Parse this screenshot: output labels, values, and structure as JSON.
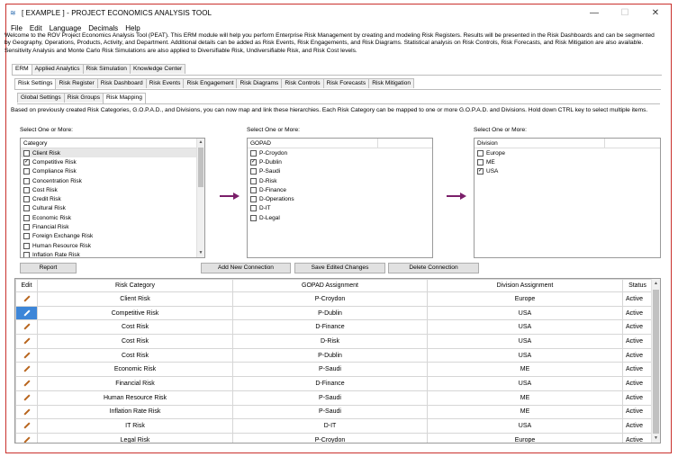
{
  "window": {
    "title": "[ EXAMPLE ] - PROJECT ECONOMICS ANALYSIS TOOL",
    "controls": {
      "minimize": "—",
      "maximize": "☐",
      "close": "✕"
    }
  },
  "menu": [
    "File",
    "Edit",
    "Language",
    "Decimals",
    "Help"
  ],
  "intro": "Welcome to the ROV Project Economics Analysis Tool (PEAT). This ERM module will help you perform Enterprise Risk Management by creating and modeling Risk Registers. Results will be presented in the Risk Dashboards and can be segmented by Geography, Operations, Products, Activity, and Department. Additional details can be added as Risk Events, Risk Engagements, and Risk Diagrams. Statistical analysis on Risk Controls, Risk Forecasts, and Risk Mitigation are also available. Sensitivity Analysis and Monte Carlo Risk Simulations are also applied to Diversifiable Risk, Undiversifiable Risk, and Risk Cost levels.",
  "main_tabs": [
    "ERM",
    "Applied Analytics",
    "Risk Simulation",
    "Knowledge Center"
  ],
  "sub_tabs": [
    "Risk Settings",
    "Risk Register",
    "Risk Dashboard",
    "Risk Events",
    "Risk Engagement",
    "Risk Diagrams",
    "Risk Controls",
    "Risk Forecasts",
    "Risk Mitigation"
  ],
  "settings_tabs": [
    "Global Settings",
    "Risk Groups",
    "Risk Mapping"
  ],
  "description": "Based on previously created Risk Categories, G.O.P.A.D., and Divisions, you can now map and link these hierarchies. Each Risk Category can be mapped to one or more G.O.P.A.D. and Divisions. Hold down CTRL key to select multiple items.",
  "select_label": "Select One or More:",
  "category_list": {
    "header": "Category",
    "items": [
      {
        "label": "Client Risk",
        "checked": false
      },
      {
        "label": "Competitive Risk",
        "checked": true
      },
      {
        "label": "Compliance Risk",
        "checked": false
      },
      {
        "label": "Concentration Risk",
        "checked": false
      },
      {
        "label": "Cost Risk",
        "checked": false
      },
      {
        "label": "Credit Risk",
        "checked": false
      },
      {
        "label": "Cultural Risk",
        "checked": false
      },
      {
        "label": "Economic Risk",
        "checked": false
      },
      {
        "label": "Financial Risk",
        "checked": false
      },
      {
        "label": "Foreign Exchange Risk",
        "checked": false
      },
      {
        "label": "Human Resource Risk",
        "checked": false
      },
      {
        "label": "Inflation Rate Risk",
        "checked": false
      }
    ]
  },
  "gopad_list": {
    "header": "GOPAD",
    "items": [
      {
        "label": "P-Croydon",
        "checked": false
      },
      {
        "label": "P-Dublin",
        "checked": true
      },
      {
        "label": "P-Saudi",
        "checked": false
      },
      {
        "label": "D-Risk",
        "checked": false
      },
      {
        "label": "D-Finance",
        "checked": false
      },
      {
        "label": "D-Operations",
        "checked": false
      },
      {
        "label": "D-IT",
        "checked": false
      },
      {
        "label": "D-Legal",
        "checked": false
      }
    ]
  },
  "division_list": {
    "header": "Division",
    "items": [
      {
        "label": "Europe",
        "checked": false
      },
      {
        "label": "ME",
        "checked": false
      },
      {
        "label": "USA",
        "checked": true
      }
    ]
  },
  "buttons": {
    "report": "Report",
    "add": "Add New Connection",
    "save": "Save Edited Changes",
    "delete": "Delete Connection"
  },
  "grid": {
    "columns": [
      "Edit",
      "Risk Category",
      "GOPAD Assignment",
      "Division Assignment",
      "Status"
    ],
    "rows": [
      [
        "Client Risk",
        "P-Croydon",
        "Europe",
        "Active"
      ],
      [
        "Competitive Risk",
        "P-Dublin",
        "USA",
        "Active"
      ],
      [
        "Cost Risk",
        "D-Finance",
        "USA",
        "Active"
      ],
      [
        "Cost Risk",
        "D-Risk",
        "USA",
        "Active"
      ],
      [
        "Cost Risk",
        "P-Dublin",
        "USA",
        "Active"
      ],
      [
        "Economic Risk",
        "P-Saudi",
        "ME",
        "Active"
      ],
      [
        "Financial Risk",
        "D-Finance",
        "USA",
        "Active"
      ],
      [
        "Human Resource Risk",
        "P-Saudi",
        "ME",
        "Active"
      ],
      [
        "Inflation Rate Risk",
        "P-Saudi",
        "ME",
        "Active"
      ],
      [
        "IT Risk",
        "D-IT",
        "USA",
        "Active"
      ],
      [
        "Legal Risk",
        "P-Croydon",
        "Europe",
        "Active"
      ]
    ],
    "selected_row": 1
  },
  "colors": {
    "arrow": "#7b1f6a",
    "selection": "#3d86d8",
    "window_border": "#c9302c"
  },
  "icons": {
    "edit": "pencil-icon",
    "app": "app-logo-icon"
  }
}
